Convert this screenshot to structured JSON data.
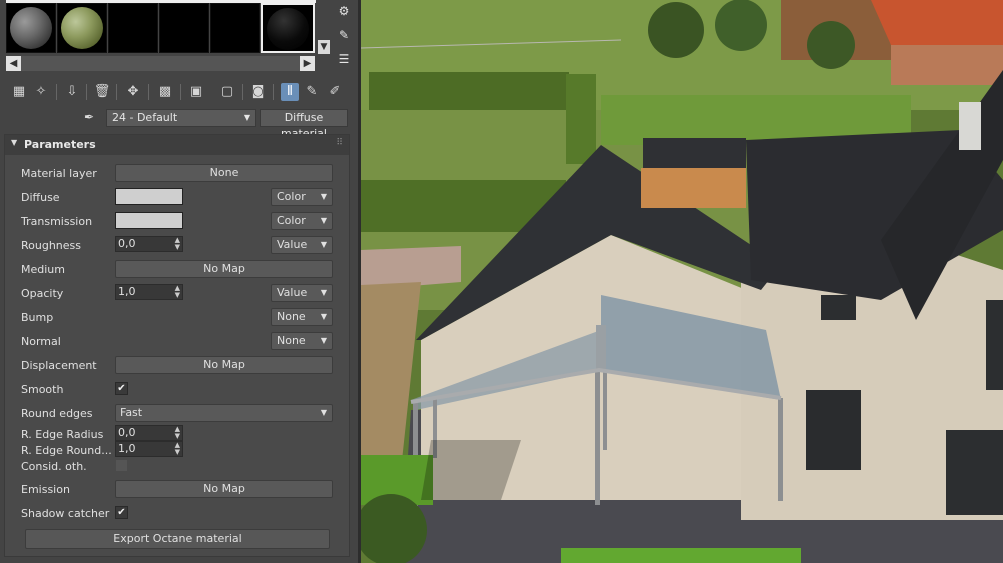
{
  "toolbar": {
    "material_slot": "24 - Default",
    "material_type": "Diffuse material",
    "slot_icons": [
      "pick-icon",
      "settings-icon",
      "list-icon"
    ],
    "tool_icons": [
      "get-material-icon",
      "put-material-icon",
      "assign-icon",
      "delete-icon",
      "make-unique-icon",
      "checker-icon",
      "save-icon",
      "material-id-icon",
      "show-map-icon",
      "show-final-icon",
      "go-parent-icon",
      "go-sibling-icon"
    ]
  },
  "rollout": {
    "title": "Parameters",
    "material_layer": {
      "label": "Material layer",
      "value": "None"
    },
    "diffuse": {
      "label": "Diffuse",
      "mode": "Color",
      "color": "#cfcfcf"
    },
    "transmission": {
      "label": "Transmission",
      "mode": "Color",
      "color": "#cfcfcf"
    },
    "roughness": {
      "label": "Roughness",
      "value": "0,0",
      "mode": "Value"
    },
    "medium": {
      "label": "Medium",
      "value": "No Map"
    },
    "opacity": {
      "label": "Opacity",
      "value": "1,0",
      "mode": "Value"
    },
    "bump": {
      "label": "Bump",
      "mode": "None"
    },
    "normal": {
      "label": "Normal",
      "mode": "None"
    },
    "displacement": {
      "label": "Displacement",
      "value": "No Map"
    },
    "smooth": {
      "label": "Smooth",
      "checked": true
    },
    "round_edges": {
      "label": "Round edges",
      "value": "Fast"
    },
    "edge_radius": {
      "label": "R. Edge Radius",
      "value": "0,0"
    },
    "edge_roundness": {
      "label": "R. Edge Round...",
      "value": "1,0"
    },
    "consider_other": {
      "label": "Consid. oth.",
      "checked": false
    },
    "emission": {
      "label": "Emission",
      "value": "No Map"
    },
    "shadow_catcher": {
      "label": "Shadow catcher",
      "checked": true
    },
    "export_label": "Export Octane material"
  },
  "colors": {
    "panel_bg": "#444444",
    "rollout_bg": "#4a4a4a",
    "active_tool": "#6a8fb8"
  }
}
